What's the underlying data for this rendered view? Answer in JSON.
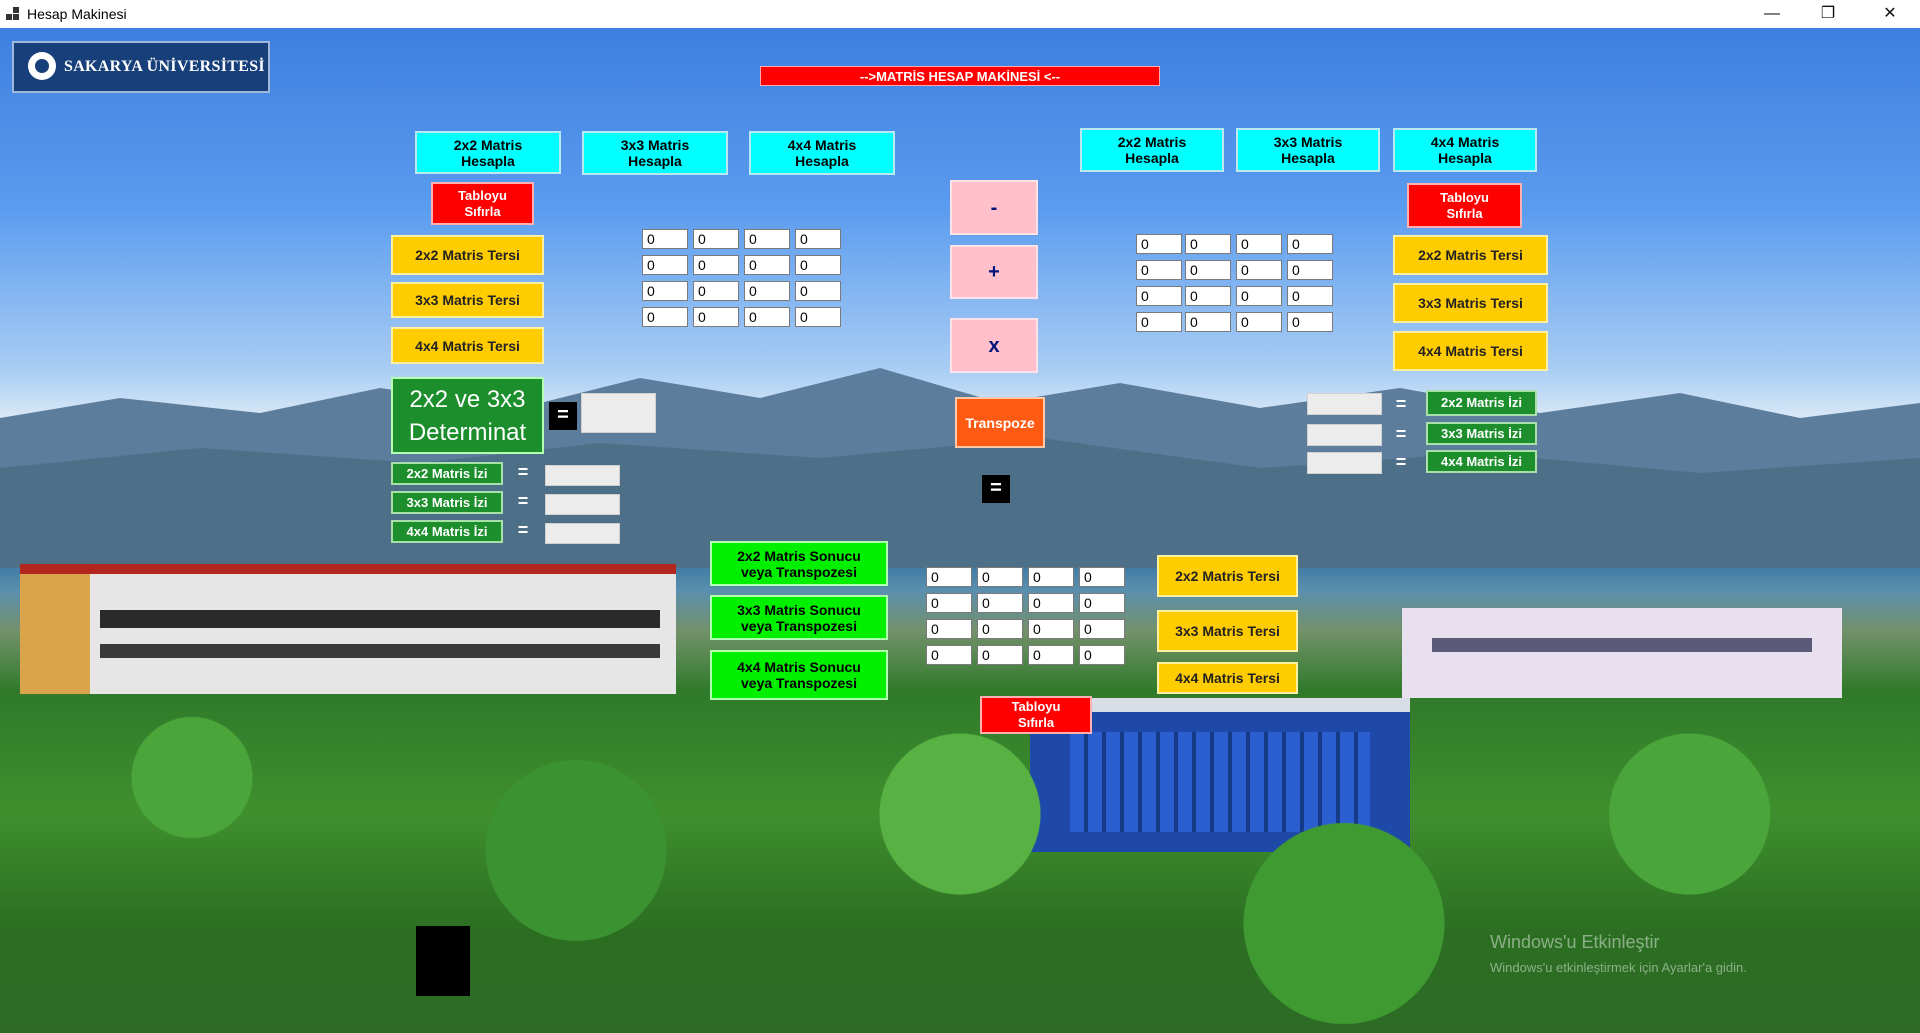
{
  "window": {
    "title": "Hesap Makinesi",
    "min_label": "—",
    "max_label": "❐",
    "close_label": "✕"
  },
  "logo": {
    "text": "SAKARYA ÜNİVERSİTESİ"
  },
  "header": {
    "title": "-->MATRİS HESAP MAKİNESİ <--"
  },
  "left": {
    "calc2": "2x2 Matris\nHesapla",
    "calc3": "3x3 Matris\nHesapla",
    "calc4": "4x4 Matris\nHesapla",
    "reset": "Tabloyu\nSıfırla",
    "inv2": "2x2 Matris Tersi",
    "inv3": "3x3 Matris Tersi",
    "inv4": "4x4 Matris Tersi",
    "det": "2x2 ve 3x3\nDeterminat",
    "det_eq": "=",
    "trace2": "2x2 Matris İzi",
    "trace3": "3x3 Matris İzi",
    "trace4": "4x4 Matris İzi",
    "eq": "="
  },
  "right": {
    "calc2": "2x2 Matris\nHesapla",
    "calc3": "3x3 Matris\nHesapla",
    "calc4": "4x4 Matris\nHesapla",
    "reset": "Tabloyu\nSıfırla",
    "inv2": "2x2 Matris Tersi",
    "inv3": "3x3 Matris Tersi",
    "inv4": "4x4 Matris Tersi",
    "trace2": "2x2 Matris İzi",
    "trace3": "3x3 Matris İzi",
    "trace4": "4x4 Matris İzi",
    "eq": "="
  },
  "ops": {
    "minus": "-",
    "plus": "+",
    "times": "x",
    "transpose": "Transpoze",
    "eq": "="
  },
  "result": {
    "res2": "2x2 Matris Sonucu\nveya Transpozesi",
    "res3": "3x3 Matris Sonucu\nveya Transpozesi",
    "res4": "4x4 Matris Sonucu\nveya Transpozesi",
    "inv2": "2x2 Matris Tersi",
    "inv3": "3x3 Matris Tersi",
    "inv4": "4x4 Matris Tersi",
    "reset": "Tabloyu\nSıfırla"
  },
  "matrixA": [
    [
      "0",
      "0",
      "0",
      "0"
    ],
    [
      "0",
      "0",
      "0",
      "0"
    ],
    [
      "0",
      "0",
      "0",
      "0"
    ],
    [
      "0",
      "0",
      "0",
      "0"
    ]
  ],
  "matrixB": [
    [
      "0",
      "0",
      "0",
      "0"
    ],
    [
      "0",
      "0",
      "0",
      "0"
    ],
    [
      "0",
      "0",
      "0",
      "0"
    ],
    [
      "0",
      "0",
      "0",
      "0"
    ]
  ],
  "matrixR": [
    [
      "0",
      "0",
      "0",
      "0"
    ],
    [
      "0",
      "0",
      "0",
      "0"
    ],
    [
      "0",
      "0",
      "0",
      "0"
    ],
    [
      "0",
      "0",
      "0",
      "0"
    ]
  ],
  "watermark": {
    "line1": "Windows'u Etkinleştir",
    "line2": "Windows'u etkinleştirmek için Ayarlar'a gidin."
  }
}
